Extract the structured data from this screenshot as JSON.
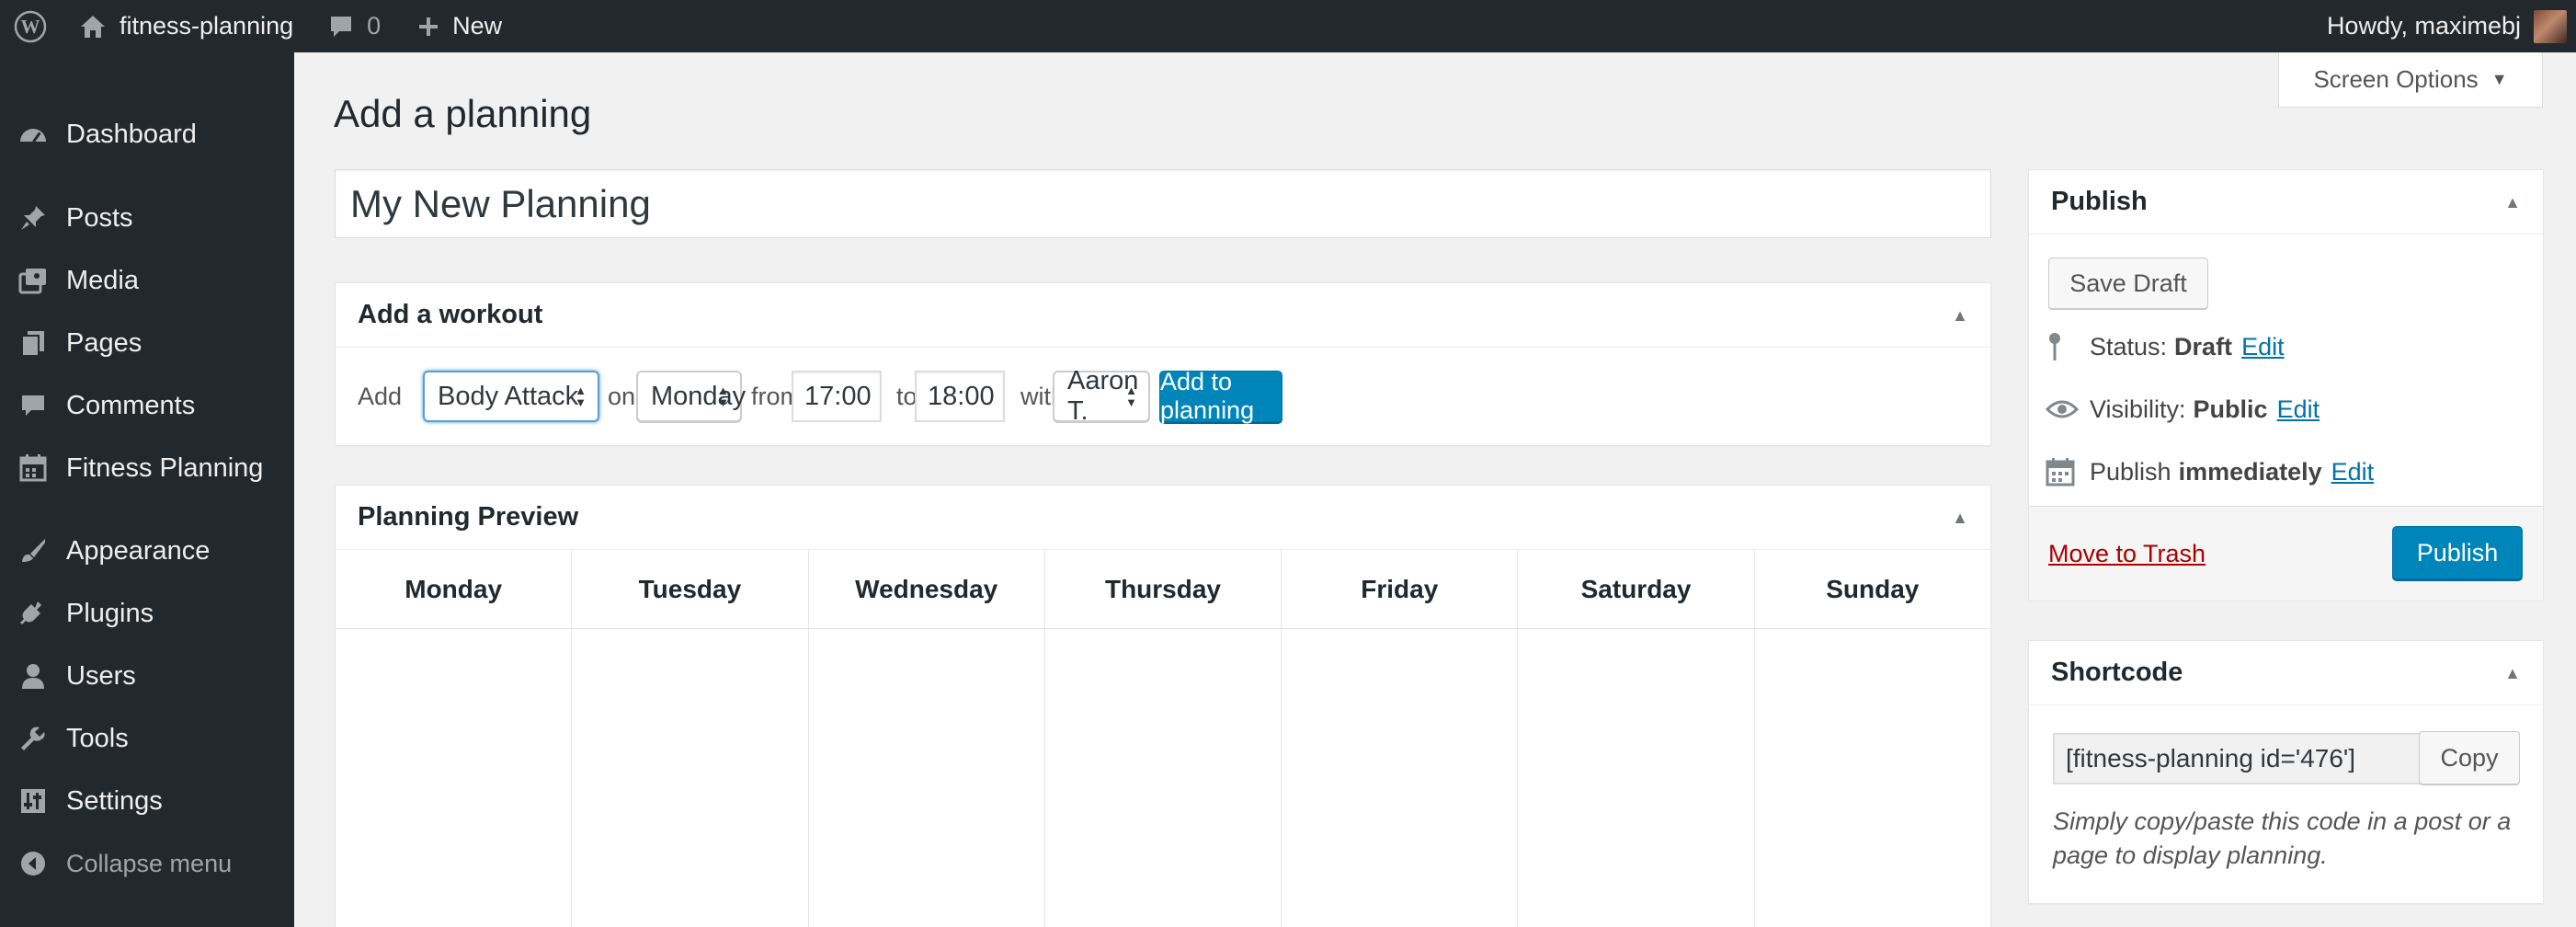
{
  "admin_bar": {
    "site_name": "fitness-planning",
    "comments_count": "0",
    "new_label": "New",
    "howdy": "Howdy, maximebj"
  },
  "menu": {
    "items": [
      {
        "label": "Dashboard",
        "icon": "dashboard-icon"
      },
      {
        "label": "Posts",
        "icon": "pin-icon"
      },
      {
        "label": "Media",
        "icon": "media-icon"
      },
      {
        "label": "Pages",
        "icon": "pages-icon"
      },
      {
        "label": "Comments",
        "icon": "comment-icon"
      },
      {
        "label": "Fitness Planning",
        "icon": "calendar-icon"
      },
      {
        "label": "Appearance",
        "icon": "brush-icon"
      },
      {
        "label": "Plugins",
        "icon": "plug-icon"
      },
      {
        "label": "Users",
        "icon": "user-icon"
      },
      {
        "label": "Tools",
        "icon": "wrench-icon"
      },
      {
        "label": "Settings",
        "icon": "settings-icon"
      }
    ],
    "collapse_label": "Collapse menu"
  },
  "screen_options": "Screen Options",
  "page_title": "Add a planning",
  "post_title_value": "My New Planning",
  "workout": {
    "heading": "Add a workout",
    "add_label": "Add",
    "workout_selected": "Body Attack",
    "on_label": "on",
    "day_selected": "Monday",
    "from_label": "from",
    "from_value": "17:00",
    "to_label": "to",
    "to_value": "18:00",
    "with_label": "with",
    "coach_selected": "Aaron T.",
    "add_button": "Add to planning"
  },
  "preview": {
    "heading": "Planning Preview",
    "days": [
      "Monday",
      "Tuesday",
      "Wednesday",
      "Thursday",
      "Friday",
      "Saturday",
      "Sunday"
    ]
  },
  "publish": {
    "heading": "Publish",
    "save_draft": "Save Draft",
    "status_label": "Status:",
    "status_value": "Draft",
    "visibility_label": "Visibility:",
    "visibility_value": "Public",
    "publish_label": "Publish",
    "publish_value": "immediately",
    "edit_link": "Edit",
    "trash_link": "Move to Trash",
    "publish_button": "Publish"
  },
  "shortcode": {
    "heading": "Shortcode",
    "value": "[fitness-planning id='476']",
    "copy_button": "Copy",
    "description": "Simply copy/paste this code in a post or a page to display planning."
  },
  "colors": {
    "admin_bar_bg": "#23282d",
    "primary_button": "#0085ba",
    "link": "#0073aa",
    "trash_link": "#a00"
  }
}
